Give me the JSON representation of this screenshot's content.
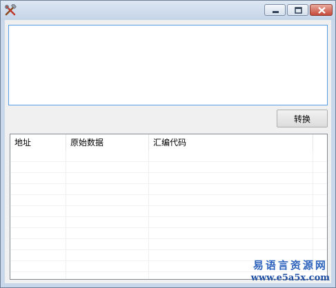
{
  "window": {
    "icon": "tools-icon",
    "controls": {
      "minimize": "minimize-icon",
      "maximize": "maximize-icon",
      "close": "close-icon"
    }
  },
  "editor": {
    "value": "",
    "placeholder": ""
  },
  "convert_button": {
    "label": "转换"
  },
  "listview": {
    "columns": [
      "地址",
      "原始数据",
      "汇编代码"
    ],
    "row_count": 12
  },
  "watermark": {
    "title": "易语言资源网",
    "url": "www.e5a5x.com"
  },
  "colors": {
    "frame": "#c8d7ea",
    "client": "#f0f0f0",
    "close_button": "#c4493a",
    "focus_border": "#569de5",
    "watermark": "#2a5fb8"
  }
}
